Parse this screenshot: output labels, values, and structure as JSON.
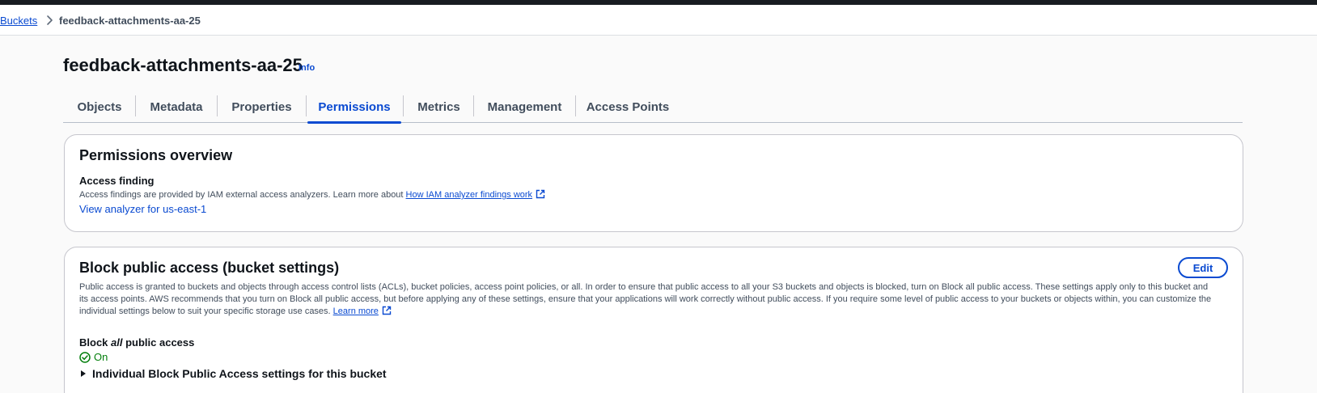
{
  "breadcrumb": {
    "parent": "Buckets",
    "current": "feedback-attachments-aa-25"
  },
  "page": {
    "title": "feedback-attachments-aa-25",
    "info_label": "Info"
  },
  "tabs": [
    {
      "label": "Objects"
    },
    {
      "label": "Metadata"
    },
    {
      "label": "Properties"
    },
    {
      "label": "Permissions",
      "active": true
    },
    {
      "label": "Metrics"
    },
    {
      "label": "Management"
    },
    {
      "label": "Access Points"
    }
  ],
  "permissions_overview": {
    "heading": "Permissions overview",
    "access_finding_label": "Access finding",
    "access_finding_text": "Access findings are provided by IAM external access analyzers. Learn more about ",
    "access_finding_link": "How IAM analyzer findings work",
    "analyzer_link": "View analyzer for us-east-1"
  },
  "block_public_access": {
    "heading": "Block public access (bucket settings)",
    "edit_label": "Edit",
    "description": "Public access is granted to buckets and objects through access control lists (ACLs), bucket policies, access point policies, or all. In order to ensure that public access to all your S3 buckets and objects is blocked, turn on Block all public access. These settings apply only to this bucket and its access points. AWS recommends that you turn on Block all public access, but before applying any of these settings, ensure that your applications will work correctly without public access. If you require some level of public access to your buckets or objects within, you can customize the individual settings below to suit your specific storage use cases.",
    "learn_more": "Learn more",
    "block_all_prefix": "Block ",
    "block_all_em": "all",
    "block_all_suffix": " public access",
    "status": "On",
    "expander_label": "Individual Block Public Access settings for this bucket"
  },
  "colors": {
    "link": "#0a4ad1",
    "success": "#037f0c",
    "topbar": "#181c21"
  },
  "icons": [
    "chevron-right-icon",
    "external-link-icon",
    "check-circle-icon",
    "caret-right-icon"
  ]
}
